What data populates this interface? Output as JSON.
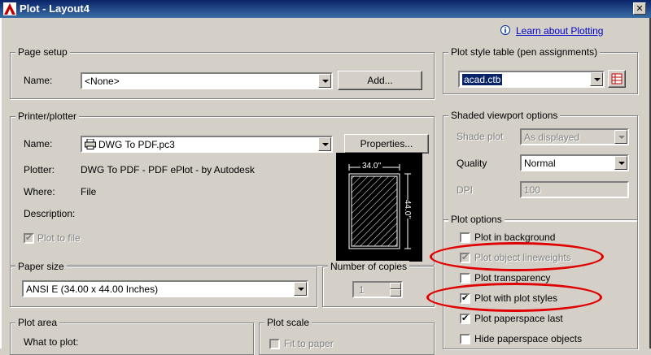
{
  "window": {
    "title": "Plot - Layout4",
    "close_glyph": "✕"
  },
  "help_link": {
    "icon": "info-icon",
    "label": "Learn about Plotting"
  },
  "page_setup": {
    "legend": "Page setup",
    "name_label": "Name:",
    "name_value": "<None>",
    "add_label": "Add..."
  },
  "printer": {
    "legend": "Printer/plotter",
    "name_label": "Name:",
    "name_value": "DWG To PDF.pc3",
    "properties_label": "Properties...",
    "plotter_label": "Plotter:",
    "plotter_value": "DWG To PDF - PDF ePlot - by Autodesk",
    "where_label": "Where:",
    "where_value": "File",
    "description_label": "Description:",
    "plot_to_file_label": "Plot to file",
    "plot_to_file_checked": true,
    "preview_width": "34.0''",
    "preview_height": "44.0''"
  },
  "paper_size": {
    "legend": "Paper size",
    "value": "ANSI E (34.00 x 44.00 Inches)"
  },
  "copies": {
    "legend": "Number of copies",
    "value": "1"
  },
  "plot_area": {
    "legend": "Plot area",
    "what_label": "What to plot:"
  },
  "plot_scale": {
    "legend": "Plot scale",
    "fit_label": "Fit to paper"
  },
  "plot_style_table": {
    "legend": "Plot style table (pen assignments)",
    "value": "acad.ctb",
    "edit_icon": "edit-table-icon"
  },
  "shaded_viewport": {
    "legend": "Shaded viewport options",
    "shade_label": "Shade plot",
    "shade_value": "As displayed",
    "quality_label": "Quality",
    "quality_value": "Normal",
    "dpi_label": "DPI",
    "dpi_value": "100"
  },
  "plot_options": {
    "legend": "Plot options",
    "items": [
      {
        "label": "Plot in background",
        "checked": false,
        "enabled": true
      },
      {
        "label": "Plot object lineweights",
        "checked": true,
        "enabled": false
      },
      {
        "label": "Plot transparency",
        "checked": false,
        "enabled": true
      },
      {
        "label": "Plot with plot styles",
        "checked": true,
        "enabled": true
      },
      {
        "label": "Plot paperspace last",
        "checked": true,
        "enabled": true
      },
      {
        "label": "Hide paperspace objects",
        "checked": false,
        "enabled": true
      }
    ]
  },
  "colors": {
    "annotation": "#e00000",
    "title_bar": "#0a246a",
    "dialog_bg": "#d4d0c8"
  }
}
